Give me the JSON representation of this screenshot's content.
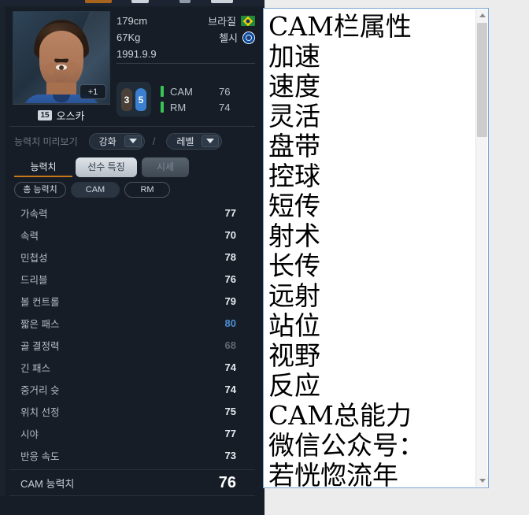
{
  "window": {
    "background_color": "#ececec",
    "panel_color": "#161d26",
    "accent_color": "#c8761c",
    "highlight_color": "#4d8fd6"
  },
  "player": {
    "photo_badge": "+1",
    "jersey_number": "15",
    "name": "오스카",
    "height": "179cm",
    "weight": "67Kg",
    "birthdate": "1991.9.9",
    "nationality": "브라질",
    "nationality_flag_icon": "brazil-flag-icon",
    "club": "첼시",
    "club_badge_icon": "chelsea-crest-icon",
    "weak_foot": "3",
    "strong_foot": "5",
    "positions": [
      {
        "name": "CAM",
        "rating": "76"
      },
      {
        "name": "RM",
        "rating": "74"
      }
    ]
  },
  "preview": {
    "label": "능력치 미리보기",
    "enhance": {
      "value": "강화",
      "icon": "chevron-down-icon"
    },
    "separator": "/",
    "level": {
      "value": "레벨",
      "icon": "chevron-down-icon"
    }
  },
  "tabs": [
    {
      "label": "능력치",
      "selected": true
    },
    {
      "label": "선수 특징",
      "selected": false
    },
    {
      "label": "시세",
      "selected": false
    }
  ],
  "subtabs": [
    {
      "label": "총 능력치",
      "selected": false
    },
    {
      "label": "CAM",
      "selected": true
    },
    {
      "label": "RM",
      "selected": false
    }
  ],
  "stats": [
    {
      "name": "가속력",
      "value": "77",
      "style": "normal"
    },
    {
      "name": "속력",
      "value": "70",
      "style": "normal"
    },
    {
      "name": "민첩성",
      "value": "78",
      "style": "normal"
    },
    {
      "name": "드리블",
      "value": "76",
      "style": "normal"
    },
    {
      "name": "볼 컨트롤",
      "value": "79",
      "style": "normal"
    },
    {
      "name": "짧은 패스",
      "value": "80",
      "style": "highlight"
    },
    {
      "name": "골 결정력",
      "value": "68",
      "style": "dim"
    },
    {
      "name": "긴 패스",
      "value": "74",
      "style": "normal"
    },
    {
      "name": "중거리 슛",
      "value": "74",
      "style": "normal"
    },
    {
      "name": "위치 선정",
      "value": "75",
      "style": "normal"
    },
    {
      "name": "시야",
      "value": "77",
      "style": "normal"
    },
    {
      "name": "반응 속도",
      "value": "73",
      "style": "normal"
    }
  ],
  "total": {
    "name": "CAM 능력치",
    "value": "76"
  },
  "notepad": {
    "lines": [
      "CAM栏属性",
      "加速",
      "速度",
      "灵活",
      "盘带",
      "控球",
      "短传",
      "射术",
      "长传",
      "远射",
      "站位",
      "视野",
      "反应",
      "CAM总能力",
      "微信公众号：",
      "若恍惚流年"
    ],
    "scrollbar": {
      "up_icon": "scroll-up-arrow-icon",
      "down_icon": "scroll-down-arrow-icon"
    }
  }
}
